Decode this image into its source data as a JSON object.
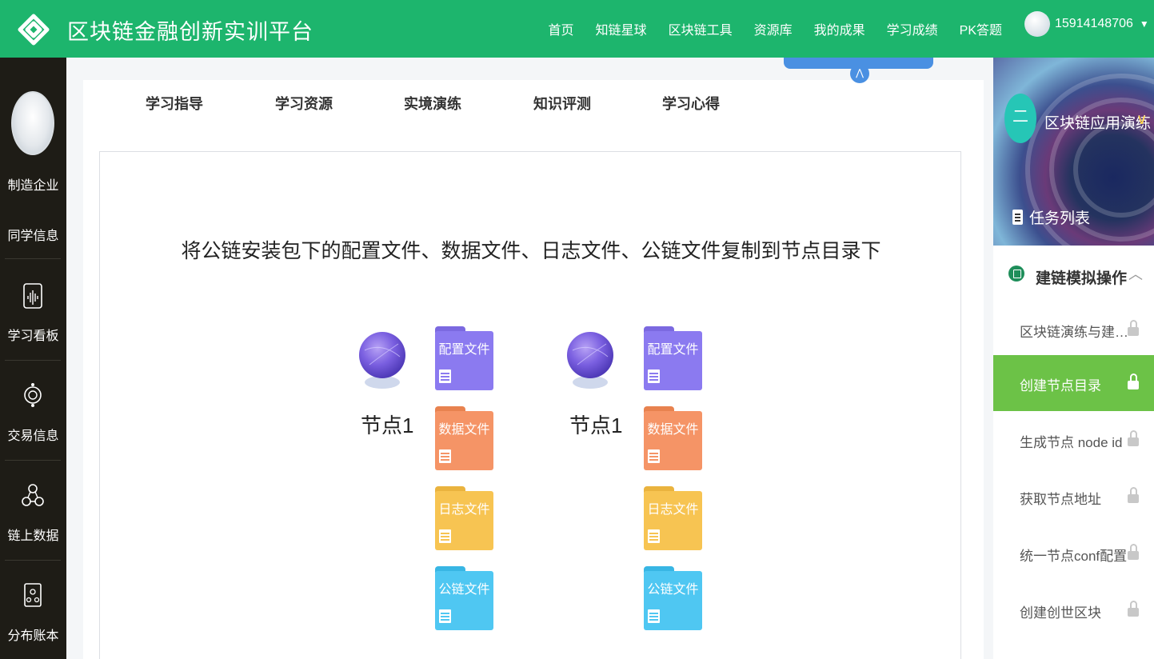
{
  "header": {
    "title": "区块链金融创新实训平台",
    "nav": [
      "首页",
      "知链星球",
      "区块链工具",
      "资源库",
      "我的成果",
      "学习成绩",
      "PK答题"
    ],
    "user": "15914148706"
  },
  "sidebar": {
    "company": "制造企业",
    "items": [
      "同学信息",
      "学习看板",
      "交易信息",
      "链上数据",
      "分布账本"
    ]
  },
  "tabs": [
    "学习指导",
    "学习资源",
    "实境演练",
    "知识评测",
    "学习心得"
  ],
  "content": {
    "instruction": "将公链安装包下的配置文件、数据文件、日志文件、公链文件复制到节点目录下",
    "nodes": [
      {
        "label": "节点1",
        "folders": [
          "配置文件",
          "数据文件",
          "日志文件",
          "公链文件"
        ]
      },
      {
        "label": "节点1",
        "folders": [
          "配置文件",
          "数据文件",
          "日志文件",
          "公链文件"
        ]
      }
    ]
  },
  "folder_colors": [
    "#8b7af0",
    "#f59466",
    "#f7c452",
    "#4fc7f2"
  ],
  "right_panel": {
    "course_badge": "二",
    "course_title": "区块链应用演练",
    "tasks_label": "任务列表",
    "section_title": "建链模拟操作",
    "tasks": [
      {
        "label": "区块链演练与建链课...",
        "active": false
      },
      {
        "label": "创建节点目录",
        "active": true
      },
      {
        "label": "生成节点 node id",
        "active": false
      },
      {
        "label": "获取节点地址",
        "active": false
      },
      {
        "label": "统一节点conf配置",
        "active": false
      },
      {
        "label": "创建创世区块",
        "active": false
      }
    ]
  },
  "accent": {
    "header": "#1db56d",
    "active_task": "#6cc247",
    "sidebar": "#1e1c16"
  }
}
